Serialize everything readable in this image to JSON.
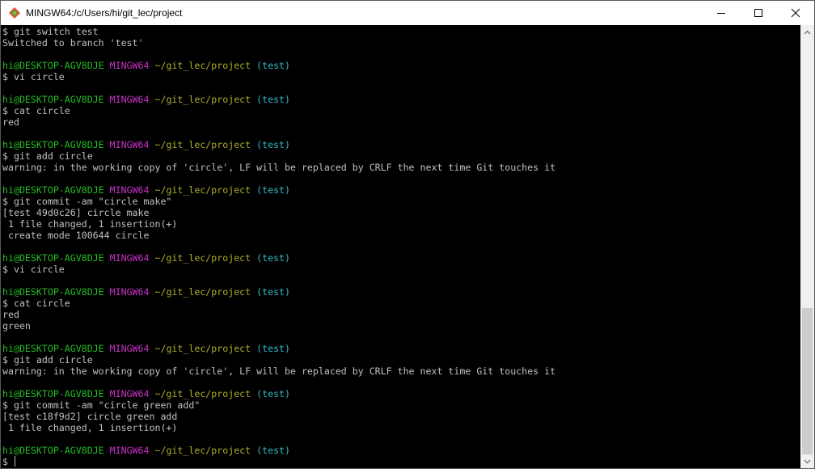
{
  "window": {
    "title": "MINGW64:/c/Users/hi/git_lec/project"
  },
  "prompt": {
    "user_host": "hi@DESKTOP-AGV8DJE",
    "system": "MINGW64",
    "path": "~/git_lec/project",
    "branch": "(test)"
  },
  "terminal": {
    "lines": [
      {
        "type": "out",
        "text": "$ git switch test"
      },
      {
        "type": "out",
        "text": "Switched to branch 'test'"
      },
      {
        "type": "blank",
        "text": ""
      },
      {
        "type": "prompt"
      },
      {
        "type": "out",
        "text": "$ vi circle"
      },
      {
        "type": "blank",
        "text": ""
      },
      {
        "type": "prompt"
      },
      {
        "type": "out",
        "text": "$ cat circle"
      },
      {
        "type": "out",
        "text": "red"
      },
      {
        "type": "blank",
        "text": ""
      },
      {
        "type": "prompt"
      },
      {
        "type": "out",
        "text": "$ git add circle"
      },
      {
        "type": "out",
        "text": "warning: in the working copy of 'circle', LF will be replaced by CRLF the next time Git touches it"
      },
      {
        "type": "blank",
        "text": ""
      },
      {
        "type": "prompt"
      },
      {
        "type": "out",
        "text": "$ git commit -am \"circle make\""
      },
      {
        "type": "out",
        "text": "[test 49d0c26] circle make"
      },
      {
        "type": "out",
        "text": " 1 file changed, 1 insertion(+)"
      },
      {
        "type": "out",
        "text": " create mode 100644 circle"
      },
      {
        "type": "blank",
        "text": ""
      },
      {
        "type": "prompt"
      },
      {
        "type": "out",
        "text": "$ vi circle"
      },
      {
        "type": "blank",
        "text": ""
      },
      {
        "type": "prompt"
      },
      {
        "type": "out",
        "text": "$ cat circle"
      },
      {
        "type": "out",
        "text": "red"
      },
      {
        "type": "out",
        "text": "green"
      },
      {
        "type": "blank",
        "text": ""
      },
      {
        "type": "prompt"
      },
      {
        "type": "out",
        "text": "$ git add circle"
      },
      {
        "type": "out",
        "text": "warning: in the working copy of 'circle', LF will be replaced by CRLF the next time Git touches it"
      },
      {
        "type": "blank",
        "text": ""
      },
      {
        "type": "prompt"
      },
      {
        "type": "out",
        "text": "$ git commit -am \"circle green add\""
      },
      {
        "type": "out",
        "text": "[test c18f9d2] circle green add"
      },
      {
        "type": "out",
        "text": " 1 file changed, 1 insertion(+)"
      },
      {
        "type": "blank",
        "text": ""
      },
      {
        "type": "prompt"
      },
      {
        "type": "input",
        "text": "$ "
      }
    ]
  },
  "colors": {
    "background": "#000000",
    "text": "#c0c0c0",
    "user_host": "#25bc24",
    "system": "#c930c7",
    "path": "#adad27",
    "branch": "#33bbc8"
  },
  "icons": {
    "app": "git-bash-diamond-icon",
    "minimize": "minimize-icon",
    "maximize": "maximize-icon",
    "close": "close-icon",
    "scroll_up": "chevron-up-icon",
    "scroll_down": "chevron-down-icon"
  }
}
